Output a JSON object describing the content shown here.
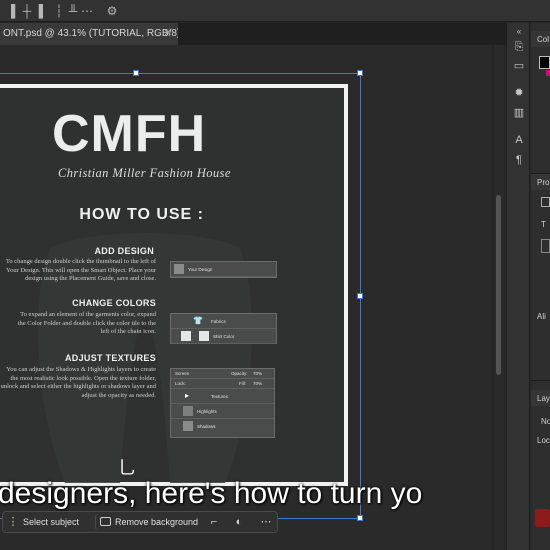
{
  "document": {
    "tab_title": "ONT.psd @ 43.1% (TUTORIAL, RGB/8)",
    "close_glyph": "✕"
  },
  "options_bar": {
    "icons": [
      "align-left-icon",
      "align-center-icon",
      "align-right-icon",
      "distribute-icon",
      "align-top-icon",
      "align-middle-icon",
      "align-bottom-icon",
      "more-options-icon",
      "settings-gear-icon"
    ]
  },
  "artboard": {
    "logo": "CMFH",
    "logo_subtitle": "Christian Miller Fashion House",
    "how_to_use": "HOW TO USE :",
    "sections": {
      "add_design": {
        "title": "ADD DESIGN",
        "body": "To change design double click the thumbnail to the left of Your Design. This will open the Smart Object. Place your design using the Placement Guide, save and close."
      },
      "change_colors": {
        "title": "CHANGE COLORS",
        "body": "To expand an element of the garments color, expand the Color Folder and double click the color tile to the left of the chain icon."
      },
      "adjust_textures": {
        "title": "ADJUST TEXTURES",
        "body": "You can adjust the Shadows & Highlights layers to create the most realistic look possible. Open the texture folder, unlock and select either the highlights or shadows layer and adjust the opacity as needed."
      }
    },
    "layer_panels": {
      "design": {
        "layer": "Your Design"
      },
      "colors": {
        "layers": [
          "Fabrics",
          "Shirt Color"
        ]
      },
      "textures": {
        "blend_mode": "Screen",
        "opacity_label": "Opacity:",
        "opacity_value": "70%",
        "lock_label": "Lock:",
        "fill_label": "Fill:",
        "fill_value": "70%",
        "layers": [
          "Textures",
          "Highlights",
          "Shadows"
        ]
      }
    }
  },
  "caption": "designers, here's how to turn yo",
  "task_bar": {
    "select_subject": "Select subject",
    "remove_background": "Remove background",
    "icons": [
      "transform-icon",
      "adjustment-icon",
      "more-icon"
    ]
  },
  "tool_strip": {
    "icons": [
      "history-icon",
      "comments-icon",
      "brush-settings-icon",
      "levels-icon",
      "character-icon",
      "paragraph-icon"
    ]
  },
  "right_panels": {
    "labels": [
      "Col",
      "Pro",
      "T",
      "Ali",
      "Lay",
      "No",
      "Loc"
    ],
    "collapse_glyph": "«"
  },
  "colors": {
    "accent_selection": "#3a7bd5",
    "foreground_swatch": "#000000",
    "background_swatch": "#ffffff",
    "warning_magenta": "#e0008a",
    "delete_red": "#8e1b1b"
  }
}
